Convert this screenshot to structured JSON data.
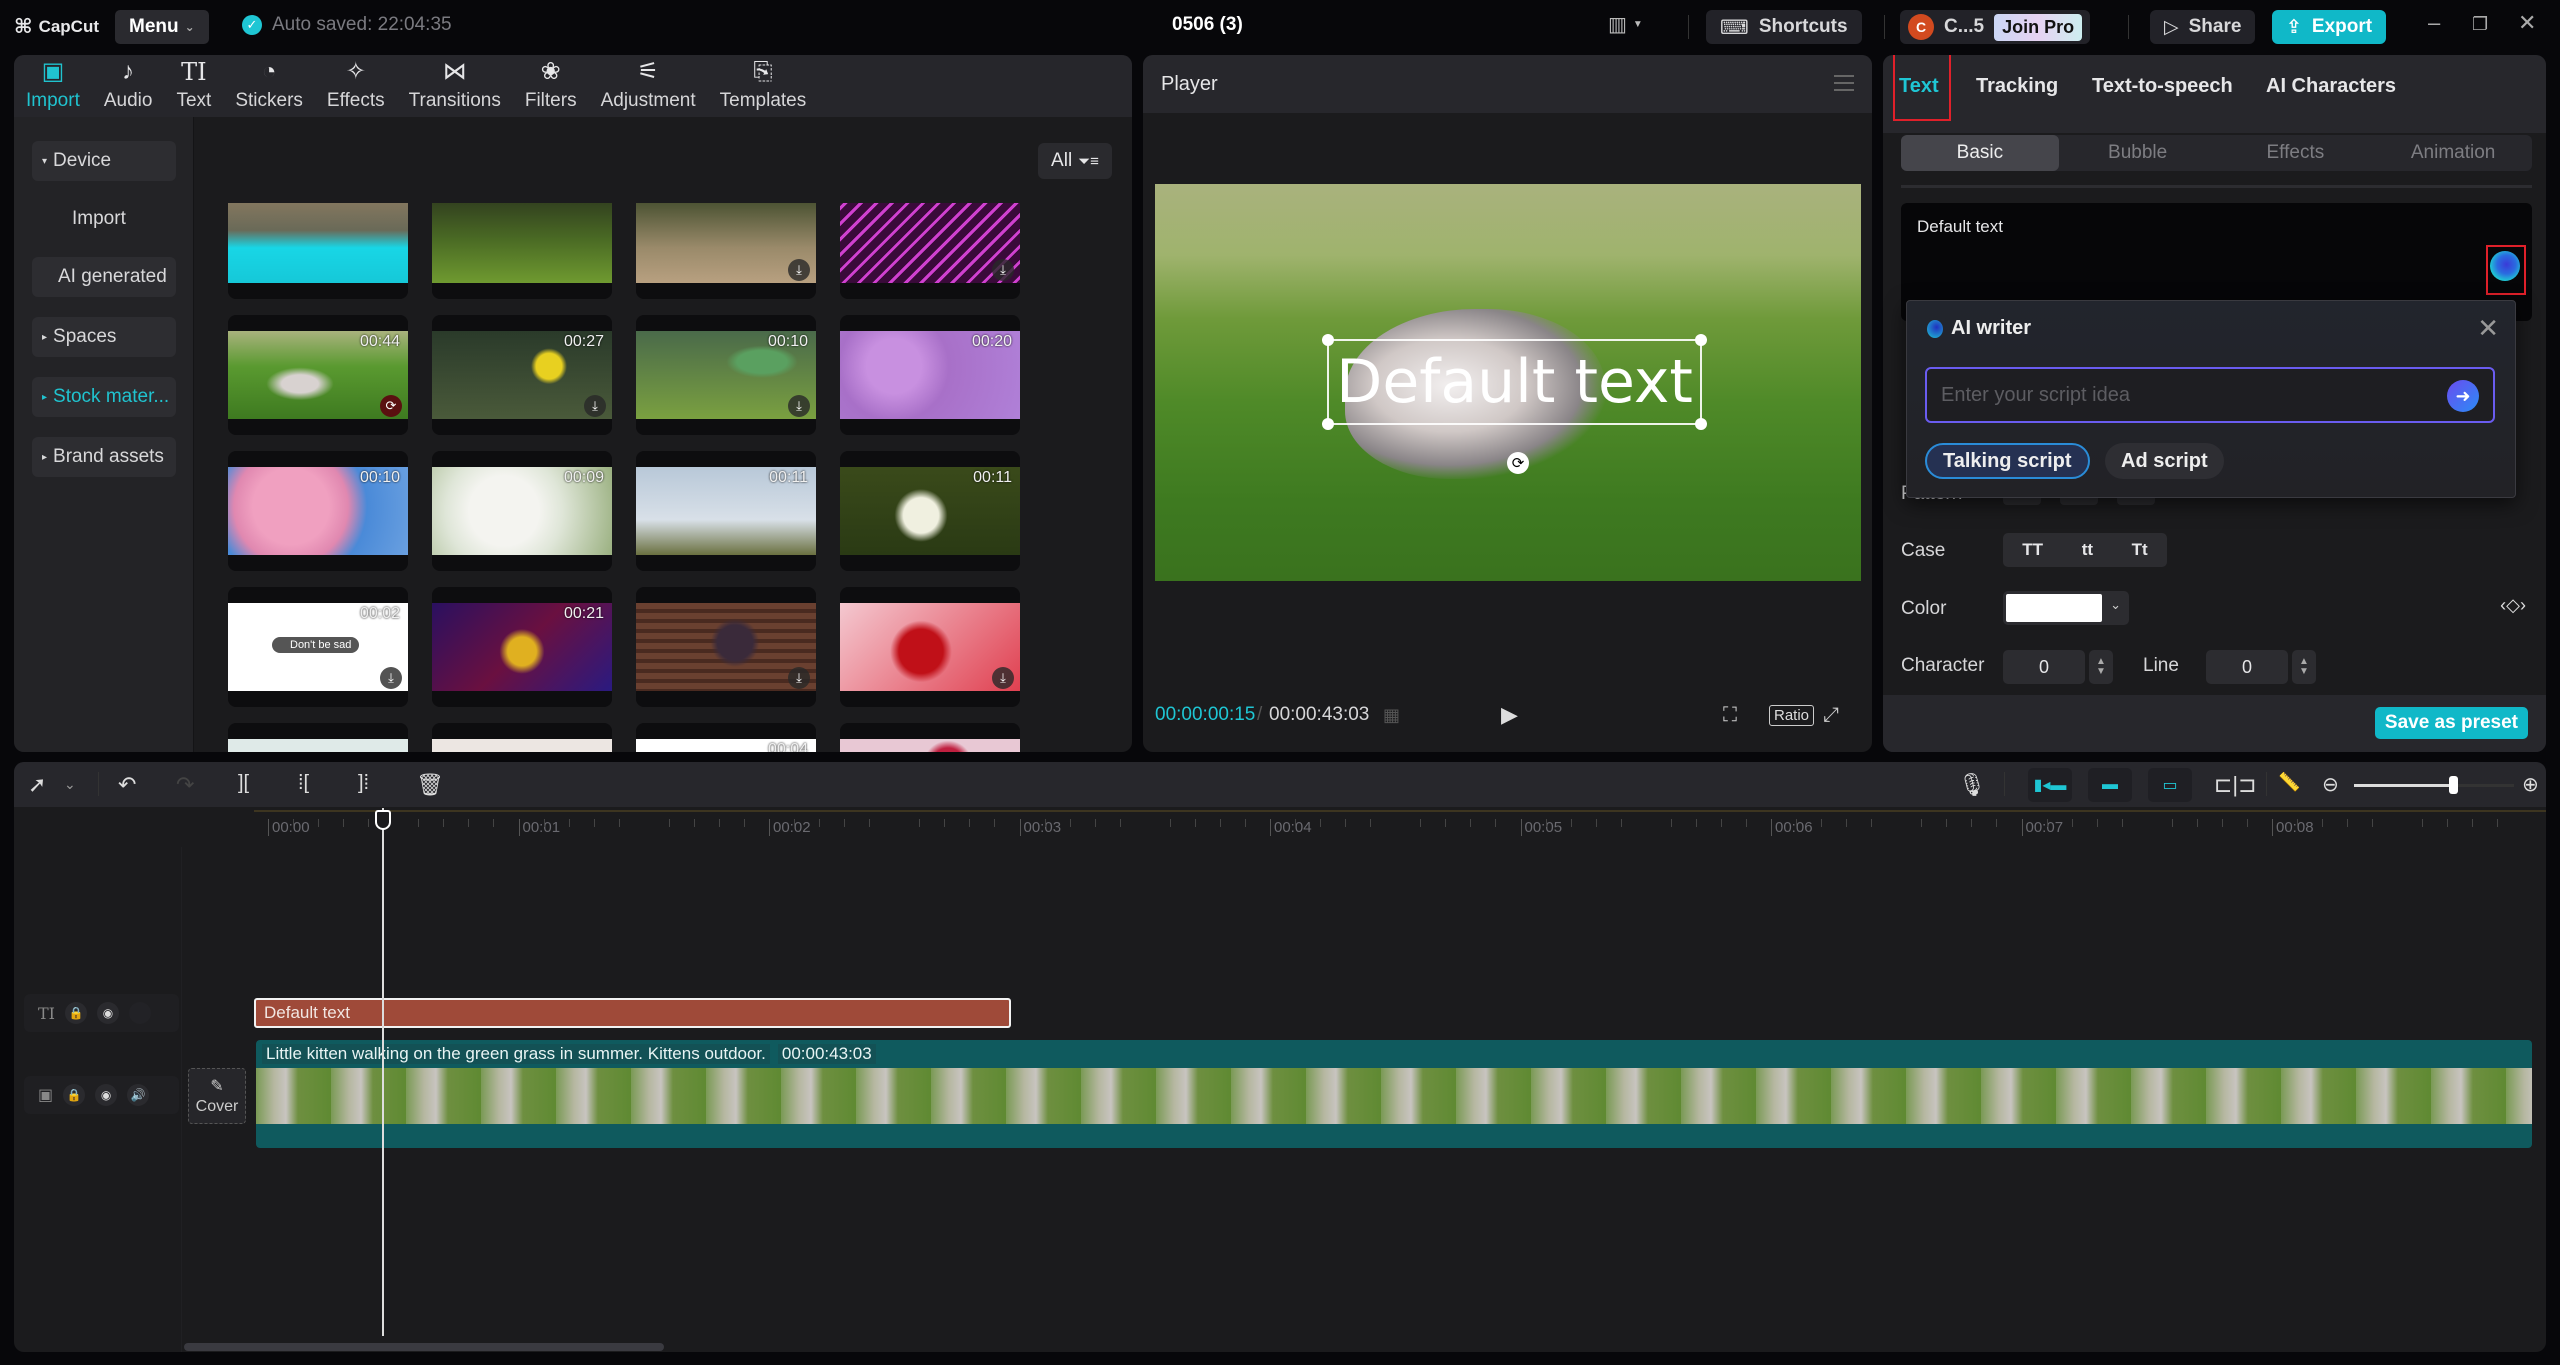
{
  "app": {
    "logo": "CapCut",
    "menu_label": "Menu",
    "autosave": "Auto saved: 22:04:35",
    "project_title": "0506 (3)",
    "shortcuts_label": "Shortcuts",
    "account_initial": "C",
    "account_name": "C...5",
    "join_pro_label": "Join Pro",
    "share_label": "Share",
    "export_label": "Export",
    "colors": {
      "accent": "#1fc6d4",
      "export_bg": "#10b8c8",
      "text_clip": "#9f4a39",
      "video_clip": "#0f5a5e",
      "highlight_box": "#e0202a"
    }
  },
  "media_tools": [
    {
      "label": "Import",
      "icon": "import-icon",
      "active": true
    },
    {
      "label": "Audio",
      "icon": "audio-icon"
    },
    {
      "label": "Text",
      "icon": "text-icon"
    },
    {
      "label": "Stickers",
      "icon": "stickers-icon"
    },
    {
      "label": "Effects",
      "icon": "effects-icon"
    },
    {
      "label": "Transitions",
      "icon": "transitions-icon"
    },
    {
      "label": "Filters",
      "icon": "filters-icon"
    },
    {
      "label": "Adjustment",
      "icon": "adjustment-icon"
    },
    {
      "label": "Templates",
      "icon": "templates-icon"
    }
  ],
  "sidebar": {
    "items": [
      {
        "label": "Device",
        "arrow": "▾"
      },
      {
        "label": "Import",
        "arrow": ""
      },
      {
        "label": "AI generated",
        "arrow": ""
      },
      {
        "label": "Spaces",
        "arrow": "▸"
      },
      {
        "label": "Stock mater...",
        "arrow": "▸",
        "active": true
      },
      {
        "label": "Brand assets",
        "arrow": "▸"
      }
    ]
  },
  "filter": {
    "label": "All"
  },
  "media_grid": [
    {
      "name": "pool-splash",
      "duration": "",
      "download": false
    },
    {
      "name": "people-on-grass",
      "duration": "",
      "download": false
    },
    {
      "name": "rocky-trail",
      "duration": "",
      "download": true
    },
    {
      "name": "neon-heart",
      "duration": "",
      "download": true
    },
    {
      "name": "kitten-on-grass",
      "duration": "00:44",
      "download": false,
      "loading": true
    },
    {
      "name": "daffodils",
      "duration": "00:27",
      "download": true
    },
    {
      "name": "watering-can",
      "duration": "00:10",
      "download": true
    },
    {
      "name": "lilac",
      "duration": "00:20",
      "download": false
    },
    {
      "name": "pink-blossom",
      "duration": "00:10",
      "download": false
    },
    {
      "name": "white-blossom",
      "duration": "00:09",
      "download": false
    },
    {
      "name": "motocross-jump",
      "duration": "00:11",
      "download": false
    },
    {
      "name": "white-flowers",
      "duration": "00:11",
      "download": false
    },
    {
      "name": "dont-be-sad-toggle",
      "duration": "00:02",
      "download": true,
      "caption": "Don't be sad"
    },
    {
      "name": "happy-new-year",
      "duration": "00:21",
      "download": false
    },
    {
      "name": "cupcake-on-wood",
      "duration": "",
      "download": true
    },
    {
      "name": "red-roses",
      "duration": "",
      "download": true
    },
    {
      "name": "pink-rose",
      "duration": "",
      "download": false
    },
    {
      "name": "tulips-on-wood",
      "duration": "",
      "download": false
    },
    {
      "name": "phone-outline",
      "duration": "00:04",
      "download": false
    },
    {
      "name": "gift-roses",
      "duration": "",
      "download": false
    }
  ],
  "player": {
    "title": "Player",
    "overlay_text": "Default text",
    "current_time": "00:00:00:15",
    "duration": "00:00:43:03",
    "ratio_label": "Ratio"
  },
  "inspector": {
    "tabs": [
      {
        "label": "Text",
        "active": true
      },
      {
        "label": "Tracking"
      },
      {
        "label": "Text-to-speech"
      },
      {
        "label": "AI Characters"
      }
    ],
    "subtabs": [
      {
        "label": "Basic",
        "active": true
      },
      {
        "label": "Bubble"
      },
      {
        "label": "Effects"
      },
      {
        "label": "Animation"
      }
    ],
    "text_value": "Default text",
    "pattern_label": "Pattern",
    "case_label": "Case",
    "case_options": [
      "TT",
      "tt",
      "Tt"
    ],
    "color_label": "Color",
    "color_value": "#ffffff",
    "character_label": "Character",
    "character_value": "0",
    "line_label": "Line",
    "line_value": "0",
    "save_preset_label": "Save as preset"
  },
  "ai_writer": {
    "title": "AI writer",
    "placeholder": "Enter your script idea",
    "chips": [
      {
        "label": "Talking script",
        "selected": true
      },
      {
        "label": "Ad script",
        "selected": false
      }
    ]
  },
  "timeline": {
    "ruler": [
      "00:00",
      "00:01",
      "00:02",
      "00:03",
      "00:04",
      "00:05",
      "00:06",
      "00:07",
      "00:08"
    ],
    "zoom_level": 0.62,
    "text_clip_label": "Default text",
    "video_clip_label": "Little kitten walking on the green grass in summer. Kittens outdoor.",
    "video_clip_duration": "00:00:43:03",
    "cover_label": "Cover"
  }
}
